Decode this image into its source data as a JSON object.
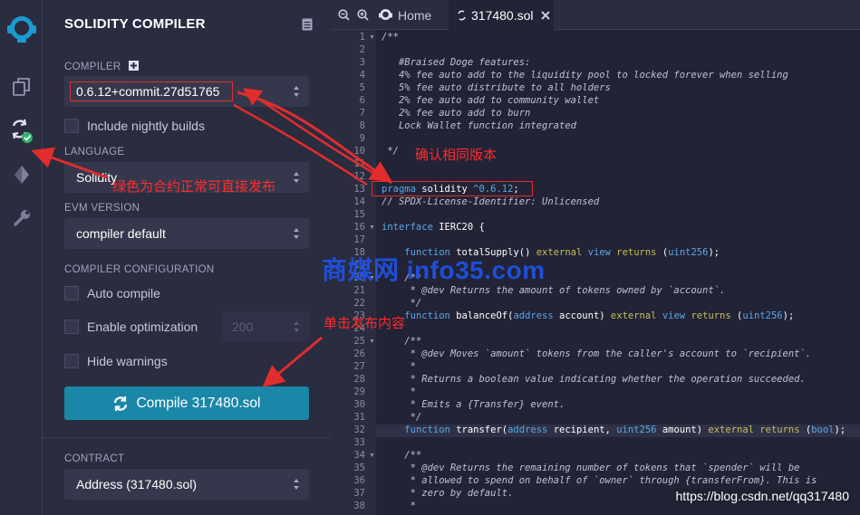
{
  "rail": {
    "items": [
      "logo-icon",
      "file-explorer-icon",
      "solidity-compiler-icon",
      "deploy-run-icon",
      "settings-icon"
    ]
  },
  "panel": {
    "title": "SOLIDITY COMPILER",
    "compiler_label": "COMPILER",
    "compiler_value": "0.6.12+commit.27d51765",
    "nightly_label": "Include nightly builds",
    "language_label": "LANGUAGE",
    "language_value": "Solidity",
    "evm_label": "EVM VERSION",
    "evm_value": "compiler default",
    "config_label": "COMPILER CONFIGURATION",
    "auto_compile": "Auto compile",
    "optimization": "Enable optimization",
    "runs_value": "200",
    "hide_warnings": "Hide warnings",
    "compile_button": "Compile 317480.sol",
    "contract_label": "CONTRACT",
    "contract_value": "Address (317480.sol)"
  },
  "editor": {
    "tabs": [
      "Home",
      "317480.sol"
    ],
    "highlighted_line": 32
  },
  "annotations": {
    "confirm_version": "确认相同版本",
    "green_note": "绿色为合约正常可直接发布",
    "click_publish": "单击发布内容",
    "watermark": "商媒网 info35.com",
    "csdn": "https://blog.csdn.net/qq317480"
  },
  "colors": {
    "accent": "#1b87a8",
    "annotation_red": "#e12d2d",
    "check_green": "#2fb36b"
  }
}
